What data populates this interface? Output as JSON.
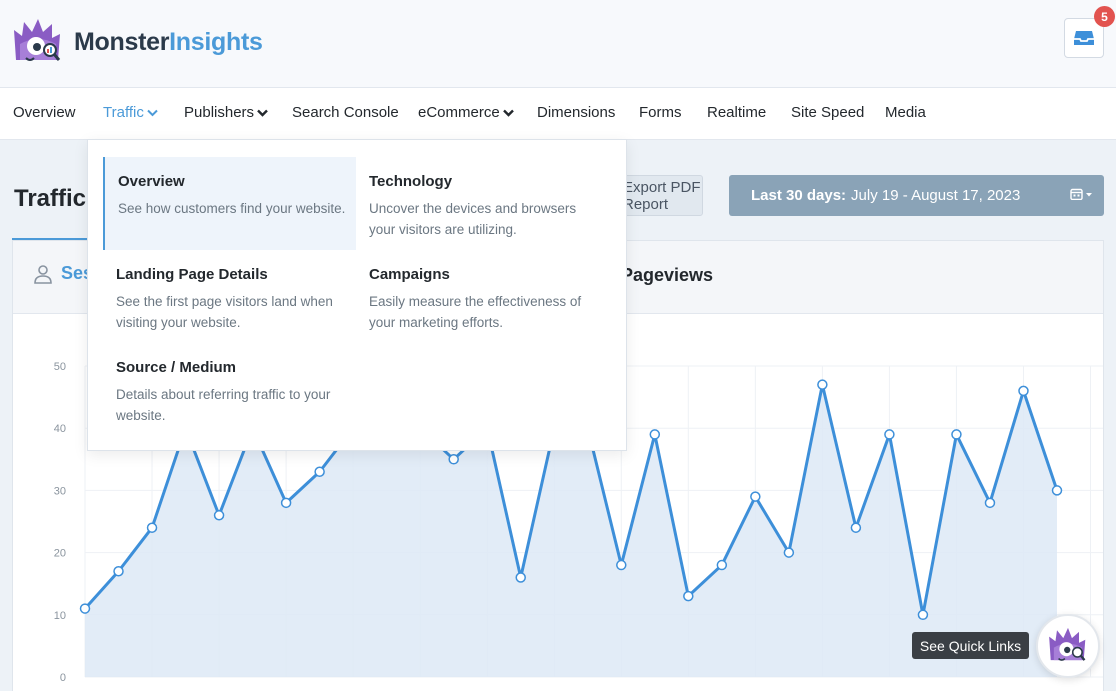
{
  "header": {
    "logo_monster": "Monster",
    "logo_insights": "Insights",
    "notification_count": "5"
  },
  "nav": {
    "items": [
      {
        "label": "Overview"
      },
      {
        "label": "Traffic",
        "active": true,
        "has_dropdown": true
      },
      {
        "label": "Publishers",
        "has_dropdown": true
      },
      {
        "label": "Search Console"
      },
      {
        "label": "eCommerce",
        "has_dropdown": true
      },
      {
        "label": "Dimensions"
      },
      {
        "label": "Forms"
      },
      {
        "label": "Realtime"
      },
      {
        "label": "Site Speed"
      },
      {
        "label": "Media"
      }
    ]
  },
  "page": {
    "title": "Traffic",
    "export_label": "Export PDF Report",
    "date_range_prefix": "Last 30 days:",
    "date_range_value": "July 19 - August 17, 2023"
  },
  "card": {
    "tab_sessions": "Sessions",
    "tab_pageviews": "Pageviews"
  },
  "dropdown": {
    "items": [
      {
        "title": "Overview",
        "description": "See how customers find your website.",
        "selected": true
      },
      {
        "title": "Technology",
        "description": "Uncover the devices and browsers your visitors are utilizing."
      },
      {
        "title": "Landing Page Details",
        "description": "See the first page visitors land when visiting your website."
      },
      {
        "title": "Campaigns",
        "description": "Easily measure the effectiveness of your marketing efforts."
      },
      {
        "title": "Source / Medium",
        "description": "Details about referring traffic to your website."
      }
    ]
  },
  "quick_links": {
    "tooltip": "See Quick Links"
  },
  "colors": {
    "accent": "#4b9ad8",
    "line": "#3d8fd9",
    "area": "#dde9f6",
    "date_button": "#8aa3b7",
    "badge": "#e2534f",
    "mascot": "#8a5cc4"
  },
  "chart_data": {
    "type": "area",
    "y_ticks": [
      "0",
      "10",
      "20",
      "30",
      "40",
      "50"
    ],
    "ylim": [
      0,
      50
    ],
    "grid": true,
    "series": [
      {
        "values": [
          11,
          17,
          24,
          40,
          26,
          40,
          28,
          33,
          40,
          40,
          40,
          35,
          40,
          16,
          40,
          40,
          18,
          39,
          13,
          18,
          29,
          20,
          47,
          24,
          39,
          10,
          39,
          28,
          46,
          30
        ]
      }
    ]
  }
}
